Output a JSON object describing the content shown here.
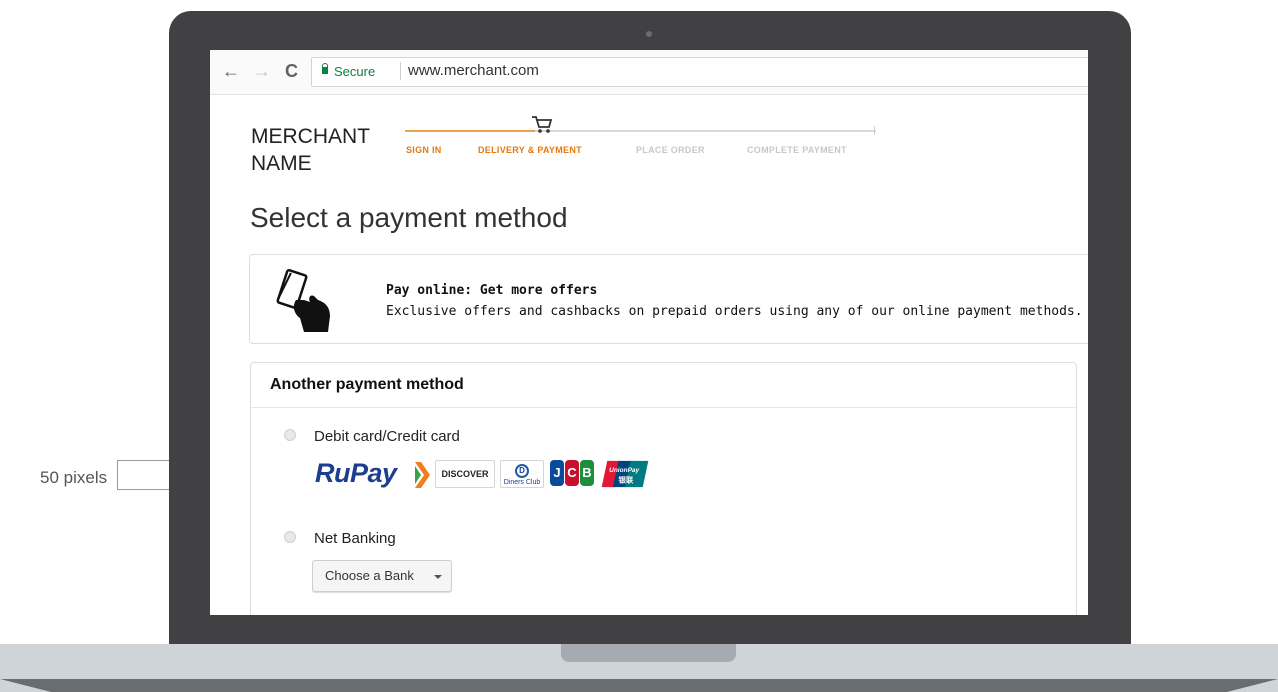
{
  "annotation": {
    "label": "50 pixels"
  },
  "browser": {
    "secure_label": "Secure",
    "url": "www.merchant.com"
  },
  "header": {
    "merchant_name": "MERCHANT NAME",
    "steps": [
      "SIGN IN",
      "DELIVERY & PAYMENT",
      "PLACE ORDER",
      "COMPLETE PAYMENT"
    ]
  },
  "page": {
    "title": "Select a payment method"
  },
  "offer": {
    "title": "Pay online: Get more offers",
    "description": "Exclusive offers and cashbacks on prepaid orders using any of our online payment methods."
  },
  "methods": {
    "title": "Another payment method",
    "card_label": "Debit card/Credit card",
    "netbanking_label": "Net Banking",
    "bank_select": "Choose a Bank"
  },
  "card_logos": {
    "rupay": "RuPay",
    "discover": "DISCOVER",
    "diners": "Diners Club",
    "diners_sub": "INTERNATIONAL",
    "jcb": [
      "J",
      "C",
      "B"
    ],
    "unionpay": "UnionPay",
    "unionpay_cn": "银联"
  },
  "colors": {
    "accent_orange": "#e47911",
    "secure_green": "#0b8043",
    "laptop_body": "#414042",
    "laptop_base": "#cfd4d9"
  }
}
